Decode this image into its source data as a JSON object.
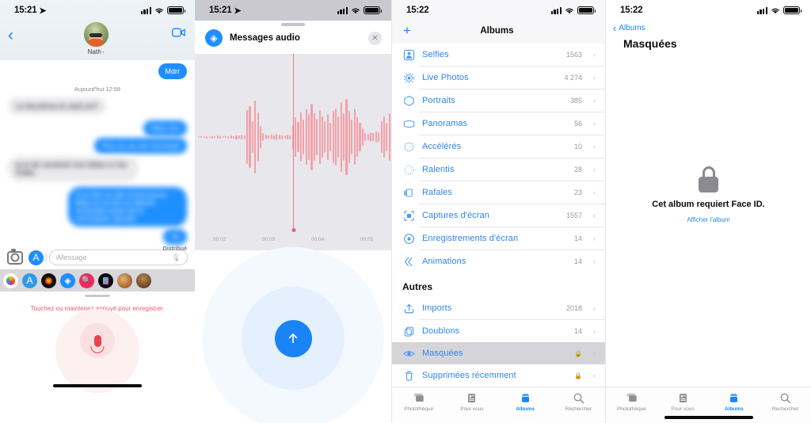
{
  "panel1": {
    "status": {
      "time": "15:21",
      "location_icon": "location-arrow-icon"
    },
    "nav": {
      "back_icon": "chevron-left-icon",
      "contact_name": "Nath",
      "contact_chevron": "›",
      "video_icon": "video-camera-icon"
    },
    "thread": {
      "first_bubble": "Mdrr",
      "daystamp": "Aujourd'hui 12:58",
      "delivered_label": "Distribué",
      "redacted": [
        "La deuxième en août oui?",
        "Mais non",
        "Plus on va voir ma loupe",
        "je te dis vendredi mes bébés si t'as d'idée",
        "A ce titre on été nnnnnooonn. Mais on se fait un débrief ensemble avant de te recontacter demain"
      ]
    },
    "inputbar": {
      "camera_icon": "camera-icon",
      "appstore_icon": "app-store-icon",
      "placeholder": "iMessage",
      "mic_icon": "microphone-icon"
    },
    "appdrawer": [
      {
        "name": "photos-app-icon"
      },
      {
        "name": "app-store-app-icon"
      },
      {
        "name": "music-app-icon"
      },
      {
        "name": "audio-messages-app-icon"
      },
      {
        "name": "image-search-app-icon"
      },
      {
        "name": "dark-note-app-icon"
      },
      {
        "name": "photo-thumbnail-1-icon"
      },
      {
        "name": "photo-thumbnail-2-icon"
      }
    ],
    "recorder": {
      "hint": "Touchez ou maintenez appuyé pour enregistrer.",
      "mic_icon": "microphone-record-icon"
    }
  },
  "panel2": {
    "status": {
      "time": "15:21",
      "location_icon": "location-arrow-icon"
    },
    "sheet": {
      "icon": "audio-messages-icon",
      "title": "Messages audio",
      "close_icon": "close-icon"
    },
    "timeline": {
      "ticks": [
        "00:02",
        "00:03",
        "00:04",
        "00:05"
      ],
      "playhead_position_pct": 50
    },
    "send": {
      "icon": "arrow-up-icon"
    }
  },
  "panel3": {
    "status": {
      "time": "15:22"
    },
    "nav": {
      "add_icon": "plus-icon",
      "title": "Albums"
    },
    "types": [
      {
        "icon": "selfies-icon",
        "label": "Selfies",
        "count": "1563"
      },
      {
        "icon": "live-photos-icon",
        "label": "Live Photos",
        "count": "4 274"
      },
      {
        "icon": "portraits-icon",
        "label": "Portraits",
        "count": "385"
      },
      {
        "icon": "panoramas-icon",
        "label": "Panoramas",
        "count": "56"
      },
      {
        "icon": "timelapse-icon",
        "label": "Accélérés",
        "count": "10"
      },
      {
        "icon": "slowmo-icon",
        "label": "Ralentis",
        "count": "28"
      },
      {
        "icon": "bursts-icon",
        "label": "Rafales",
        "count": "23"
      },
      {
        "icon": "screenshots-icon",
        "label": "Captures d'écran",
        "count": "1557"
      },
      {
        "icon": "screen-recordings-icon",
        "label": "Enregistrements d'écran",
        "count": "14"
      },
      {
        "icon": "animated-icon",
        "label": "Animations",
        "count": "14"
      }
    ],
    "others_header": "Autres",
    "others": [
      {
        "icon": "imports-icon",
        "label": "Imports",
        "count": "2018",
        "locked": false,
        "selected": false
      },
      {
        "icon": "duplicates-icon",
        "label": "Doublons",
        "count": "14",
        "locked": false,
        "selected": false
      },
      {
        "icon": "hidden-eye-icon",
        "label": "Masquées",
        "count": "",
        "locked": true,
        "selected": true
      },
      {
        "icon": "trash-icon",
        "label": "Supprimées récemment",
        "count": "",
        "locked": true,
        "selected": false
      }
    ],
    "tabs": [
      {
        "icon": "photo-library-icon",
        "label": "Photothèque",
        "active": false
      },
      {
        "icon": "for-you-icon",
        "label": "Pour vous",
        "active": false
      },
      {
        "icon": "albums-icon",
        "label": "Albums",
        "active": true
      },
      {
        "icon": "search-icon",
        "label": "Rechercher",
        "active": false
      }
    ]
  },
  "panel4": {
    "status": {
      "time": "15:22"
    },
    "back_label": "Albums",
    "title": "Masquées",
    "locked": {
      "icon": "padlock-icon",
      "message": "Cet album requiert Face ID.",
      "link": "Afficher l'album"
    },
    "tabs": [
      {
        "icon": "photo-library-icon",
        "label": "Photothèque",
        "active": false
      },
      {
        "icon": "for-you-icon",
        "label": "Pour vous",
        "active": false
      },
      {
        "icon": "albums-icon",
        "label": "Albums",
        "active": true
      },
      {
        "icon": "search-icon",
        "label": "Rechercher",
        "active": false
      }
    ]
  },
  "colors": {
    "accent_blue": "#1886f7",
    "bubble_blue": "#1e8fff",
    "record_red": "#e8414f",
    "wave_pink": "#f4a0a8"
  }
}
